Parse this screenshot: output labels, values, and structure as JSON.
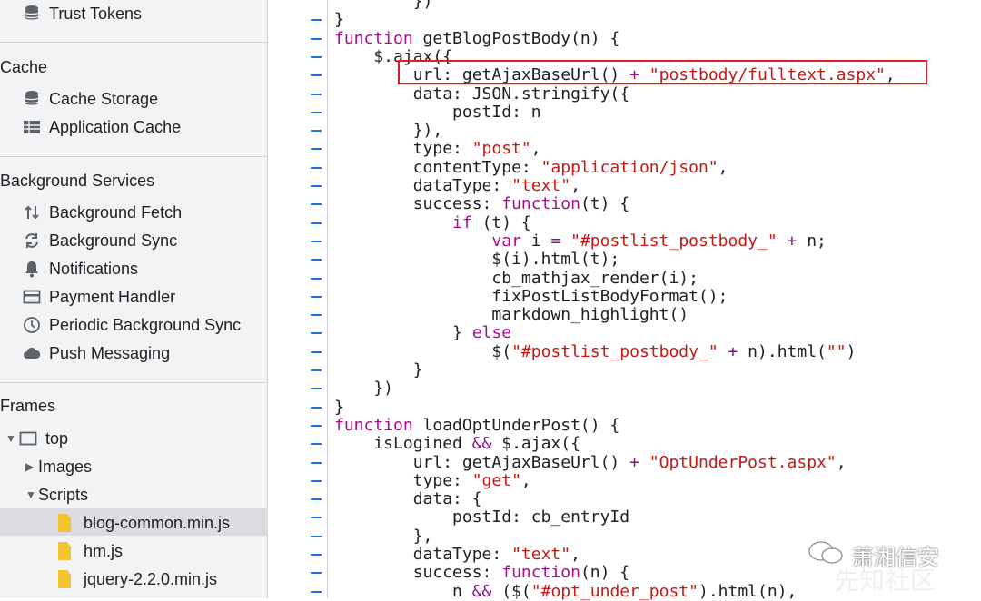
{
  "sidebar": {
    "trust_tokens": "Trust Tokens",
    "cache_header": "Cache",
    "cache_storage": "Cache Storage",
    "application_cache": "Application Cache",
    "bg_header": "Background Services",
    "bg_fetch": "Background Fetch",
    "bg_sync": "Background Sync",
    "notifications": "Notifications",
    "payment_handler": "Payment Handler",
    "periodic_sync": "Periodic Background Sync",
    "push_messaging": "Push Messaging",
    "frames_header": "Frames",
    "top": "top",
    "images": "Images",
    "scripts": "Scripts",
    "files": [
      "blog-common.min.js",
      "hm.js",
      "jquery-2.2.0.min.js"
    ]
  },
  "code": {
    "lines": [
      "        })",
      "}",
      "function getBlogPostBody(n) {",
      "    $.ajax({",
      "        url: getAjaxBaseUrl() + \"postbody/fulltext.aspx\",",
      "        data: JSON.stringify({",
      "            postId: n",
      "        }),",
      "        type: \"post\",",
      "        contentType: \"application/json\",",
      "        dataType: \"text\",",
      "        success: function(t) {",
      "            if (t) {",
      "                var i = \"#postlist_postbody_\" + n;",
      "                $(i).html(t);",
      "                cb_mathjax_render(i);",
      "                fixPostListBodyFormat();",
      "                markdown_highlight()",
      "            } else",
      "                $(\"#postlist_postbody_\" + n).html(\"\")",
      "        }",
      "    })",
      "}",
      "function loadOptUnderPost() {",
      "    isLogined && $.ajax({",
      "        url: getAjaxBaseUrl() + \"OptUnderPost.aspx\",",
      "        type: \"get\",",
      "        data: {",
      "            postId: cb_entryId",
      "        },",
      "        dataType: \"text\",",
      "        success: function(n) {",
      "            n && ($(\"#opt_under_post\").html(n),"
    ]
  },
  "watermark": {
    "text": "萧湘信安",
    "text2": "先知社区"
  },
  "colors": {
    "highlight_box": "#e11b22",
    "gutter_dash": "#1a73e8",
    "keyword": "#aa0d91",
    "string": "#c41a16"
  }
}
